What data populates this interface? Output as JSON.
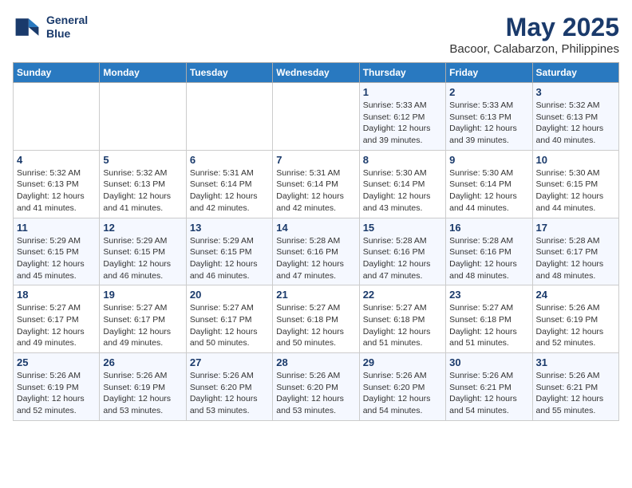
{
  "header": {
    "logo_line1": "General",
    "logo_line2": "Blue",
    "title": "May 2025",
    "subtitle": "Bacoor, Calabarzon, Philippines"
  },
  "days_of_week": [
    "Sunday",
    "Monday",
    "Tuesday",
    "Wednesday",
    "Thursday",
    "Friday",
    "Saturday"
  ],
  "weeks": [
    [
      {
        "day": "",
        "info": ""
      },
      {
        "day": "",
        "info": ""
      },
      {
        "day": "",
        "info": ""
      },
      {
        "day": "",
        "info": ""
      },
      {
        "day": "1",
        "info": "Sunrise: 5:33 AM\nSunset: 6:12 PM\nDaylight: 12 hours\nand 39 minutes."
      },
      {
        "day": "2",
        "info": "Sunrise: 5:33 AM\nSunset: 6:13 PM\nDaylight: 12 hours\nand 39 minutes."
      },
      {
        "day": "3",
        "info": "Sunrise: 5:32 AM\nSunset: 6:13 PM\nDaylight: 12 hours\nand 40 minutes."
      }
    ],
    [
      {
        "day": "4",
        "info": "Sunrise: 5:32 AM\nSunset: 6:13 PM\nDaylight: 12 hours\nand 41 minutes."
      },
      {
        "day": "5",
        "info": "Sunrise: 5:32 AM\nSunset: 6:13 PM\nDaylight: 12 hours\nand 41 minutes."
      },
      {
        "day": "6",
        "info": "Sunrise: 5:31 AM\nSunset: 6:14 PM\nDaylight: 12 hours\nand 42 minutes."
      },
      {
        "day": "7",
        "info": "Sunrise: 5:31 AM\nSunset: 6:14 PM\nDaylight: 12 hours\nand 42 minutes."
      },
      {
        "day": "8",
        "info": "Sunrise: 5:30 AM\nSunset: 6:14 PM\nDaylight: 12 hours\nand 43 minutes."
      },
      {
        "day": "9",
        "info": "Sunrise: 5:30 AM\nSunset: 6:14 PM\nDaylight: 12 hours\nand 44 minutes."
      },
      {
        "day": "10",
        "info": "Sunrise: 5:30 AM\nSunset: 6:15 PM\nDaylight: 12 hours\nand 44 minutes."
      }
    ],
    [
      {
        "day": "11",
        "info": "Sunrise: 5:29 AM\nSunset: 6:15 PM\nDaylight: 12 hours\nand 45 minutes."
      },
      {
        "day": "12",
        "info": "Sunrise: 5:29 AM\nSunset: 6:15 PM\nDaylight: 12 hours\nand 46 minutes."
      },
      {
        "day": "13",
        "info": "Sunrise: 5:29 AM\nSunset: 6:15 PM\nDaylight: 12 hours\nand 46 minutes."
      },
      {
        "day": "14",
        "info": "Sunrise: 5:28 AM\nSunset: 6:16 PM\nDaylight: 12 hours\nand 47 minutes."
      },
      {
        "day": "15",
        "info": "Sunrise: 5:28 AM\nSunset: 6:16 PM\nDaylight: 12 hours\nand 47 minutes."
      },
      {
        "day": "16",
        "info": "Sunrise: 5:28 AM\nSunset: 6:16 PM\nDaylight: 12 hours\nand 48 minutes."
      },
      {
        "day": "17",
        "info": "Sunrise: 5:28 AM\nSunset: 6:17 PM\nDaylight: 12 hours\nand 48 minutes."
      }
    ],
    [
      {
        "day": "18",
        "info": "Sunrise: 5:27 AM\nSunset: 6:17 PM\nDaylight: 12 hours\nand 49 minutes."
      },
      {
        "day": "19",
        "info": "Sunrise: 5:27 AM\nSunset: 6:17 PM\nDaylight: 12 hours\nand 49 minutes."
      },
      {
        "day": "20",
        "info": "Sunrise: 5:27 AM\nSunset: 6:17 PM\nDaylight: 12 hours\nand 50 minutes."
      },
      {
        "day": "21",
        "info": "Sunrise: 5:27 AM\nSunset: 6:18 PM\nDaylight: 12 hours\nand 50 minutes."
      },
      {
        "day": "22",
        "info": "Sunrise: 5:27 AM\nSunset: 6:18 PM\nDaylight: 12 hours\nand 51 minutes."
      },
      {
        "day": "23",
        "info": "Sunrise: 5:27 AM\nSunset: 6:18 PM\nDaylight: 12 hours\nand 51 minutes."
      },
      {
        "day": "24",
        "info": "Sunrise: 5:26 AM\nSunset: 6:19 PM\nDaylight: 12 hours\nand 52 minutes."
      }
    ],
    [
      {
        "day": "25",
        "info": "Sunrise: 5:26 AM\nSunset: 6:19 PM\nDaylight: 12 hours\nand 52 minutes."
      },
      {
        "day": "26",
        "info": "Sunrise: 5:26 AM\nSunset: 6:19 PM\nDaylight: 12 hours\nand 53 minutes."
      },
      {
        "day": "27",
        "info": "Sunrise: 5:26 AM\nSunset: 6:20 PM\nDaylight: 12 hours\nand 53 minutes."
      },
      {
        "day": "28",
        "info": "Sunrise: 5:26 AM\nSunset: 6:20 PM\nDaylight: 12 hours\nand 53 minutes."
      },
      {
        "day": "29",
        "info": "Sunrise: 5:26 AM\nSunset: 6:20 PM\nDaylight: 12 hours\nand 54 minutes."
      },
      {
        "day": "30",
        "info": "Sunrise: 5:26 AM\nSunset: 6:21 PM\nDaylight: 12 hours\nand 54 minutes."
      },
      {
        "day": "31",
        "info": "Sunrise: 5:26 AM\nSunset: 6:21 PM\nDaylight: 12 hours\nand 55 minutes."
      }
    ]
  ]
}
